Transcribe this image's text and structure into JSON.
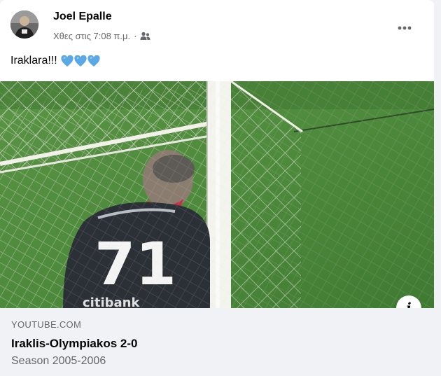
{
  "post": {
    "author_name": "Joel Epalle",
    "timestamp": "Χθες στις 7:08 π.μ.",
    "separator": "·",
    "audience_icon": "friends-icon",
    "more_icon": "more-horizontal-icon",
    "message_text": "Iraklara!!!",
    "message_emojis": [
      "blue-heart",
      "blue-heart",
      "blue-heart"
    ]
  },
  "link_preview": {
    "domain": "YOUTUBE.COM",
    "title": "Iraklis-Olympiakos 2-0",
    "description": "Season 2005-2006",
    "info_label": "i",
    "thumbnail_jersey_number": "71",
    "thumbnail_sponsor": "citibank"
  },
  "colors": {
    "primary_text": "#050505",
    "secondary_text": "#65676b",
    "link_box_bg": "#f0f2f5",
    "heart": "#5aa9e6",
    "pitch_green": "#4e8a3c",
    "jersey": "#2b2f36"
  }
}
